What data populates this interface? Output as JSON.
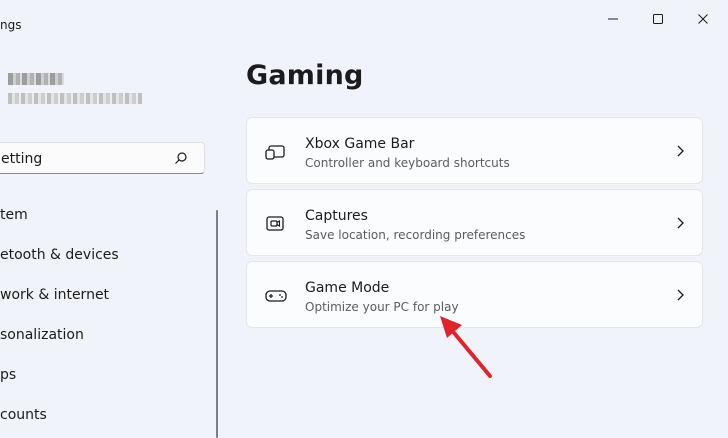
{
  "window": {
    "title": "ngs",
    "controls": [
      "minimize-icon",
      "maximize-icon",
      "close-icon"
    ]
  },
  "sidebar": {
    "search": {
      "value": "etting"
    },
    "items": [
      {
        "label": "tem"
      },
      {
        "label": "etooth & devices"
      },
      {
        "label": "work & internet"
      },
      {
        "label": "sonalization"
      },
      {
        "label": "ps"
      },
      {
        "label": "counts"
      }
    ]
  },
  "main": {
    "title": "Gaming",
    "cards": [
      {
        "title": "Xbox Game Bar",
        "subtitle": "Controller and keyboard shortcuts",
        "icon": "xbox-game-bar-icon"
      },
      {
        "title": "Captures",
        "subtitle": "Save location, recording preferences",
        "icon": "captures-icon"
      },
      {
        "title": "Game Mode",
        "subtitle": "Optimize your PC for play",
        "icon": "game-controller-icon"
      }
    ]
  },
  "colors": {
    "background": "#f0f3f9",
    "card": "#fbfcfe",
    "annotation_arrow": "#e0242a"
  }
}
